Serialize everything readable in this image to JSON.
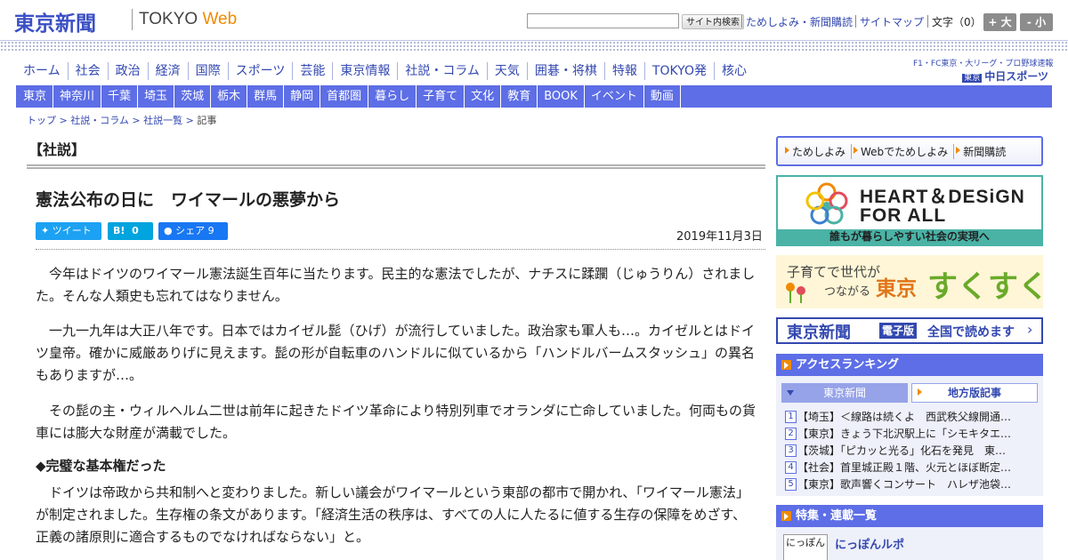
{
  "header": {
    "logo_jp": "東京新聞",
    "logo_en": "TOKYO",
    "logo_web": "Web",
    "search_button": "サイト内検索",
    "links": [
      "ためしよみ・新聞購読",
      "サイトマップ"
    ],
    "font_size_label": "文字（0）",
    "font_bigger": "+ 大",
    "font_smaller": "- 小"
  },
  "nav_main": [
    "ホーム",
    "社会",
    "政治",
    "経済",
    "国際",
    "スポーツ",
    "芸能",
    "東京情報",
    "社説・コラム",
    "天気",
    "囲碁・将棋",
    "特報",
    "TOKYO発",
    "核心"
  ],
  "chunichi": {
    "top_text": "F1・FC東京・大リーグ・プロ野球速報",
    "tag": "東京",
    "name": "中日スポーツ"
  },
  "nav_region": [
    "東京",
    "神奈川",
    "千葉",
    "埼玉",
    "茨城",
    "栃木",
    "群馬",
    "静岡",
    "首都圏",
    "暮らし",
    "子育て",
    "文化",
    "教育",
    "BOOK",
    "イベント",
    "動画"
  ],
  "breadcrumb": {
    "items": [
      "トップ",
      "社説・コラム",
      "社説一覧"
    ],
    "sep": " > ",
    "current": "記事"
  },
  "article": {
    "section": "【社説】",
    "title": "憲法公布の日に　ワイマールの悪夢から",
    "tweet_label": "ツイート",
    "hatena_label": "B!",
    "hatena_count": "0",
    "share_label": "シェア",
    "share_count": "9",
    "date": "2019年11月3日",
    "paragraphs": [
      "今年はドイツのワイマール憲法誕生百年に当たります。民主的な憲法でしたが、ナチスに蹂躙（じゅうりん）されました。そんな人類史も忘れてはなりません。",
      "一九一九年は大正八年です。日本ではカイゼル髭（ひげ）が流行していました。政治家も軍人も…。カイゼルとはドイツ皇帝。確かに威厳ありげに見えます。髭の形が自転車のハンドルに似ているから「ハンドルバームスタッシュ」の異名もありますが…。",
      "その髭の主・ウィルヘルム二世は前年に起きたドイツ革命により特別列車でオランダに亡命していました。何両もの貨車には膨大な財産が満載でした。"
    ],
    "subhead": "◆完璧な基本権だった",
    "paragraph4": "ドイツは帝政から共和制へと変わりました。新しい議会がワイマールという東部の都市で開かれ、「ワイマール憲法」が制定されました。生存権の条文があります。「経済生活の秩序は、すべての人に人たるに値する生存の保障をめざす、正義の諸原則に適合するものでなければならない」と。"
  },
  "sidebar": {
    "trial_links": [
      "ためしよみ",
      "Webでためしよみ",
      "新聞購読"
    ],
    "hd_title1": "HEART＆DESiGN",
    "hd_title2": "FOR ALL",
    "hd_sub": "誰もが暮らしやすい社会の実現へ",
    "suku_t1": "子育てで世代が",
    "suku_t2": "つながる",
    "suku_tokyo": "東京",
    "suku_sk": "すくすく",
    "e_logo": "東京新聞",
    "e_tag": "電子版",
    "e_text": "全国で読めます",
    "e_arrow": "›",
    "ranking_title": "アクセスランキング",
    "ranking_tab1": "東京新聞",
    "ranking_tab2": "地方版記事",
    "ranking": [
      {
        "num": "1",
        "text": "【埼玉】＜線路は続くよ　西武秩父線開通…"
      },
      {
        "num": "2",
        "text": "【東京】きょう下北沢駅上に「シモキタエ…"
      },
      {
        "num": "3",
        "text": "【茨城】「ピカッと光る」化石を発見　東…"
      },
      {
        "num": "4",
        "text": "【社会】首里城正殿１階、火元とほぼ断定…"
      },
      {
        "num": "5",
        "text": "【東京】歌声響くコンサート　ハレザ池袋…"
      }
    ],
    "features_title": "特集・連載一覧",
    "feature_thumb": "にっぽん",
    "feature_title": "にっぽんルポ"
  }
}
